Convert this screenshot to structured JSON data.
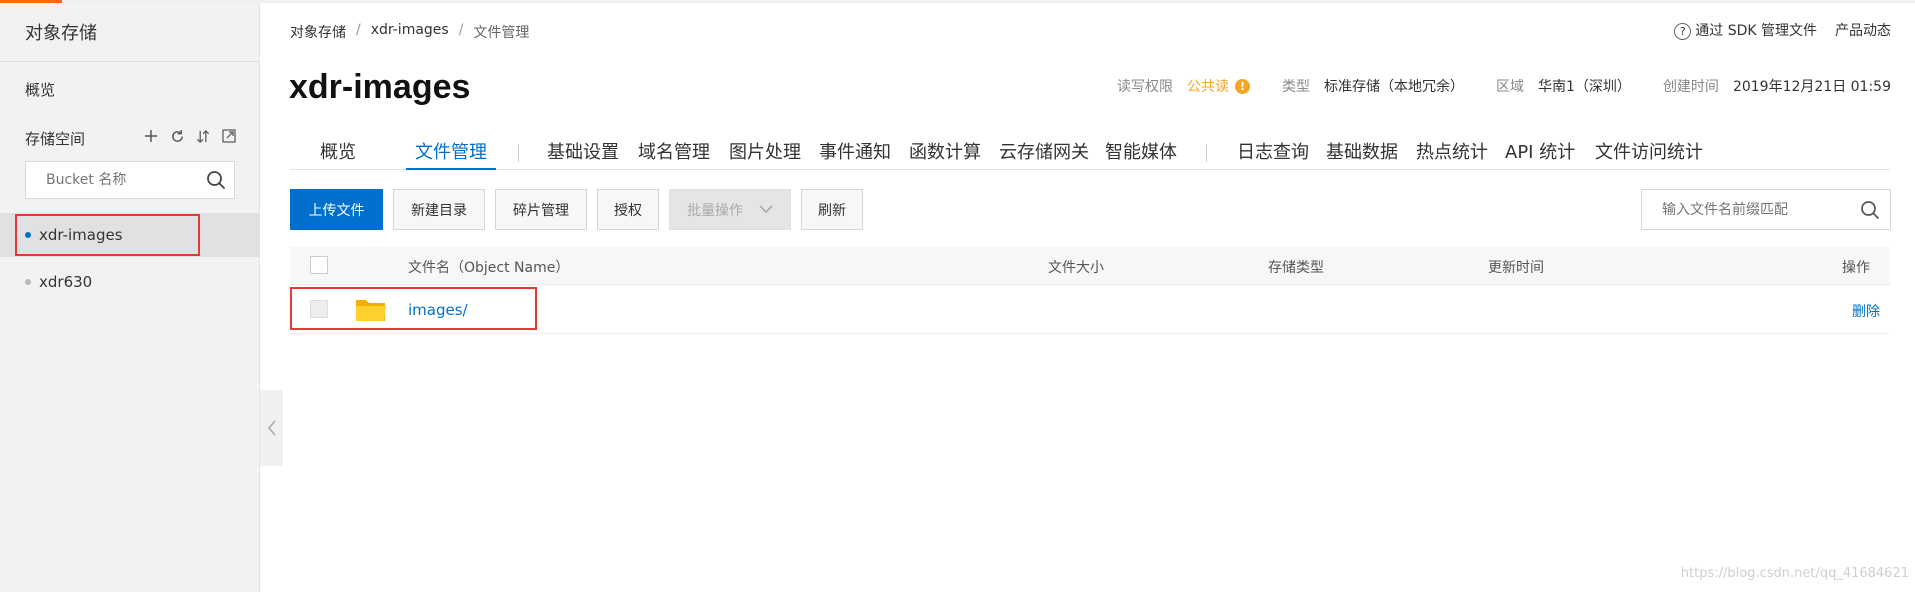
{
  "sidebar": {
    "title": "对象存储",
    "overview": "概览",
    "space_label": "存储空间",
    "search_placeholder": "Bucket 名称",
    "buckets": [
      {
        "name": "xdr-images",
        "active": true
      },
      {
        "name": "xdr630",
        "active": false
      }
    ]
  },
  "breadcrumb": [
    "对象存储",
    "xdr-images",
    "文件管理"
  ],
  "breadcrumb_sep": "/",
  "header_links": {
    "sdk": "通过 SDK 管理文件",
    "news": "产品动态"
  },
  "page_title": "xdr-images",
  "meta": {
    "perm_label": "读写权限",
    "perm_value": "公共读",
    "type_label": "类型",
    "type_value": "标准存储（本地冗余）",
    "region_label": "区域",
    "region_value": "华南1（深圳）",
    "created_label": "创建时间",
    "created_value": "2019年12月21日 01:59"
  },
  "tabs": [
    "概览",
    "文件管理",
    "基础设置",
    "域名管理",
    "图片处理",
    "事件通知",
    "函数计算",
    "云存储网关",
    "智能媒体",
    "日志查询",
    "基础数据",
    "热点统计",
    "API 统计",
    "文件访问统计"
  ],
  "active_tab": "文件管理",
  "toolbar": {
    "upload": "上传文件",
    "new_dir": "新建目录",
    "fragments": "碎片管理",
    "authorize": "授权",
    "batch": "批量操作",
    "refresh": "刷新",
    "search_placeholder": "输入文件名前缀匹配"
  },
  "table": {
    "headers": {
      "name": "文件名（Object Name）",
      "size": "文件大小",
      "storage_type": "存储类型",
      "updated": "更新时间",
      "actions": "操作"
    },
    "rows": [
      {
        "name": "images/",
        "size": "",
        "storage_type": "",
        "updated": "",
        "action": "删除"
      }
    ]
  },
  "watermark": "https://blog.csdn.net/qq_41684621",
  "colors": {
    "accent": "#0070cc",
    "brand": "#ff6a00",
    "warning": "#f5a623",
    "highlight": "#e53935"
  },
  "icons": [
    "plus-icon",
    "refresh-icon",
    "sort-icon",
    "external-link-icon",
    "search-icon",
    "chevron-left-icon",
    "help-icon",
    "warning-icon",
    "chevron-down-icon",
    "folder-icon"
  ]
}
